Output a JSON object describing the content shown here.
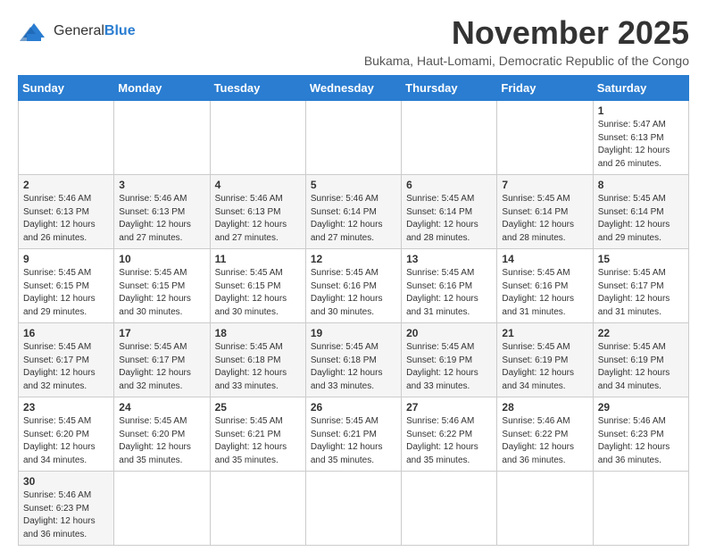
{
  "header": {
    "logo_text_general": "General",
    "logo_text_blue": "Blue",
    "month_title": "November 2025",
    "subtitle": "Bukama, Haut-Lomami, Democratic Republic of the Congo"
  },
  "weekdays": [
    "Sunday",
    "Monday",
    "Tuesday",
    "Wednesday",
    "Thursday",
    "Friday",
    "Saturday"
  ],
  "weeks": [
    [
      {
        "day": "",
        "info": ""
      },
      {
        "day": "",
        "info": ""
      },
      {
        "day": "",
        "info": ""
      },
      {
        "day": "",
        "info": ""
      },
      {
        "day": "",
        "info": ""
      },
      {
        "day": "",
        "info": ""
      },
      {
        "day": "1",
        "info": "Sunrise: 5:47 AM\nSunset: 6:13 PM\nDaylight: 12 hours\nand 26 minutes."
      }
    ],
    [
      {
        "day": "2",
        "info": "Sunrise: 5:46 AM\nSunset: 6:13 PM\nDaylight: 12 hours\nand 26 minutes."
      },
      {
        "day": "3",
        "info": "Sunrise: 5:46 AM\nSunset: 6:13 PM\nDaylight: 12 hours\nand 27 minutes."
      },
      {
        "day": "4",
        "info": "Sunrise: 5:46 AM\nSunset: 6:13 PM\nDaylight: 12 hours\nand 27 minutes."
      },
      {
        "day": "5",
        "info": "Sunrise: 5:46 AM\nSunset: 6:14 PM\nDaylight: 12 hours\nand 27 minutes."
      },
      {
        "day": "6",
        "info": "Sunrise: 5:45 AM\nSunset: 6:14 PM\nDaylight: 12 hours\nand 28 minutes."
      },
      {
        "day": "7",
        "info": "Sunrise: 5:45 AM\nSunset: 6:14 PM\nDaylight: 12 hours\nand 28 minutes."
      },
      {
        "day": "8",
        "info": "Sunrise: 5:45 AM\nSunset: 6:14 PM\nDaylight: 12 hours\nand 29 minutes."
      }
    ],
    [
      {
        "day": "9",
        "info": "Sunrise: 5:45 AM\nSunset: 6:15 PM\nDaylight: 12 hours\nand 29 minutes."
      },
      {
        "day": "10",
        "info": "Sunrise: 5:45 AM\nSunset: 6:15 PM\nDaylight: 12 hours\nand 30 minutes."
      },
      {
        "day": "11",
        "info": "Sunrise: 5:45 AM\nSunset: 6:15 PM\nDaylight: 12 hours\nand 30 minutes."
      },
      {
        "day": "12",
        "info": "Sunrise: 5:45 AM\nSunset: 6:16 PM\nDaylight: 12 hours\nand 30 minutes."
      },
      {
        "day": "13",
        "info": "Sunrise: 5:45 AM\nSunset: 6:16 PM\nDaylight: 12 hours\nand 31 minutes."
      },
      {
        "day": "14",
        "info": "Sunrise: 5:45 AM\nSunset: 6:16 PM\nDaylight: 12 hours\nand 31 minutes."
      },
      {
        "day": "15",
        "info": "Sunrise: 5:45 AM\nSunset: 6:17 PM\nDaylight: 12 hours\nand 31 minutes."
      }
    ],
    [
      {
        "day": "16",
        "info": "Sunrise: 5:45 AM\nSunset: 6:17 PM\nDaylight: 12 hours\nand 32 minutes."
      },
      {
        "day": "17",
        "info": "Sunrise: 5:45 AM\nSunset: 6:17 PM\nDaylight: 12 hours\nand 32 minutes."
      },
      {
        "day": "18",
        "info": "Sunrise: 5:45 AM\nSunset: 6:18 PM\nDaylight: 12 hours\nand 33 minutes."
      },
      {
        "day": "19",
        "info": "Sunrise: 5:45 AM\nSunset: 6:18 PM\nDaylight: 12 hours\nand 33 minutes."
      },
      {
        "day": "20",
        "info": "Sunrise: 5:45 AM\nSunset: 6:19 PM\nDaylight: 12 hours\nand 33 minutes."
      },
      {
        "day": "21",
        "info": "Sunrise: 5:45 AM\nSunset: 6:19 PM\nDaylight: 12 hours\nand 34 minutes."
      },
      {
        "day": "22",
        "info": "Sunrise: 5:45 AM\nSunset: 6:19 PM\nDaylight: 12 hours\nand 34 minutes."
      }
    ],
    [
      {
        "day": "23",
        "info": "Sunrise: 5:45 AM\nSunset: 6:20 PM\nDaylight: 12 hours\nand 34 minutes."
      },
      {
        "day": "24",
        "info": "Sunrise: 5:45 AM\nSunset: 6:20 PM\nDaylight: 12 hours\nand 35 minutes."
      },
      {
        "day": "25",
        "info": "Sunrise: 5:45 AM\nSunset: 6:21 PM\nDaylight: 12 hours\nand 35 minutes."
      },
      {
        "day": "26",
        "info": "Sunrise: 5:45 AM\nSunset: 6:21 PM\nDaylight: 12 hours\nand 35 minutes."
      },
      {
        "day": "27",
        "info": "Sunrise: 5:46 AM\nSunset: 6:22 PM\nDaylight: 12 hours\nand 35 minutes."
      },
      {
        "day": "28",
        "info": "Sunrise: 5:46 AM\nSunset: 6:22 PM\nDaylight: 12 hours\nand 36 minutes."
      },
      {
        "day": "29",
        "info": "Sunrise: 5:46 AM\nSunset: 6:23 PM\nDaylight: 12 hours\nand 36 minutes."
      }
    ],
    [
      {
        "day": "30",
        "info": "Sunrise: 5:46 AM\nSunset: 6:23 PM\nDaylight: 12 hours\nand 36 minutes."
      },
      {
        "day": "",
        "info": ""
      },
      {
        "day": "",
        "info": ""
      },
      {
        "day": "",
        "info": ""
      },
      {
        "day": "",
        "info": ""
      },
      {
        "day": "",
        "info": ""
      },
      {
        "day": "",
        "info": ""
      }
    ]
  ]
}
